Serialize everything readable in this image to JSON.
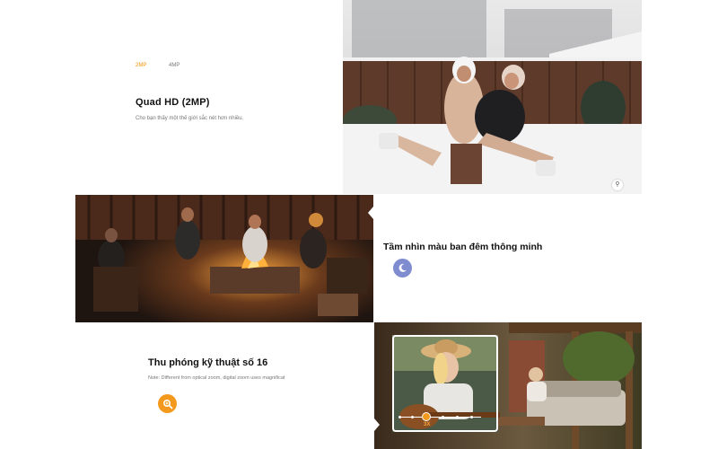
{
  "resolution_tabs": {
    "active": "2MP",
    "inactive": "4MP"
  },
  "section_hd": {
    "title": "Quad HD (2MP)",
    "description": "Cho bạn thấy một thế giới sắc nét hơn nhiều."
  },
  "section_night": {
    "title": "Tầm nhìn màu ban đêm thông minh",
    "icon": "moon-icon"
  },
  "section_zoom": {
    "title": "Thu phóng kỹ thuật số 16",
    "note": "Note: Different from optical zoom, digital zoom uses magnificat",
    "icon": "magnifier-icon",
    "zoom_level": "3X"
  },
  "colors": {
    "accent_orange": "#f39a1e",
    "night_blue": "#7f8ccf"
  }
}
